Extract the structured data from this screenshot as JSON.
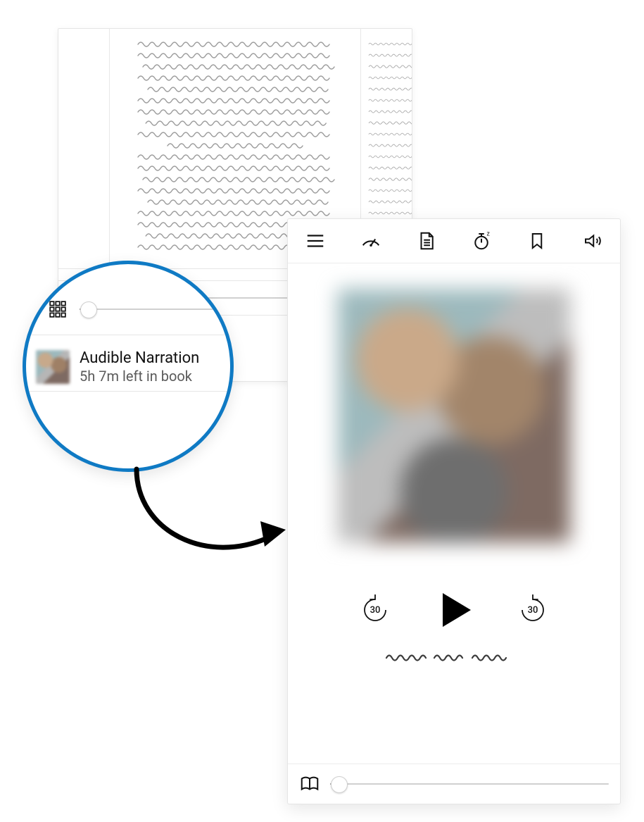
{
  "callout": {
    "title": "Audible Narration",
    "subtitle": "5h 7m left in book"
  },
  "reader": {
    "slider_pct": 6
  },
  "player": {
    "toolbar": {
      "menu": "menu",
      "speed": "speed",
      "chapters": "chapters",
      "sleep": "sleep-timer",
      "bookmark": "bookmark",
      "volume": "volume"
    },
    "skip_back_seconds": "30",
    "skip_fwd_seconds": "30",
    "progress_pct": 3
  },
  "colors": {
    "accent": "#0F7AC4"
  }
}
